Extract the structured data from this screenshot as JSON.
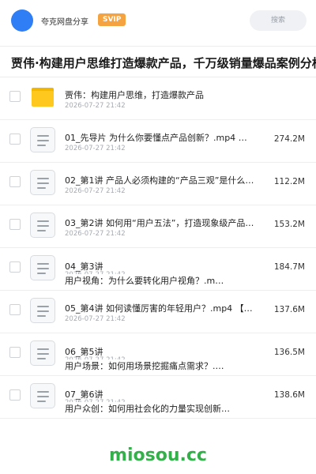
{
  "header": {
    "share_name": "夸克网盘分享",
    "badge": "SVIP",
    "search_placeholder": "搜索"
  },
  "folder_title": "贾伟·构建用户思维打造爆款产品，千万级销量爆品案例分析",
  "files": [
    {
      "type": "folder",
      "name": "贾伟：构建用户思维，打造爆款产品",
      "name2": "",
      "date": "2026-07-27 21:42",
      "size": ""
    },
    {
      "type": "file",
      "name": "01_先导片 为什么你要懂点产品创新？.mp4 【…",
      "name2": "",
      "date": "2026-07-27 21:42",
      "size": "274.2M"
    },
    {
      "type": "file",
      "name": "02_第1讲 产品人必须构建的“产品三观”是什么？…",
      "name2": "",
      "date": "2026-07-27 21:42",
      "size": "112.2M"
    },
    {
      "type": "file",
      "name": "03_第2讲 如何用“用户五法”，打造现象级产品？…",
      "name2": "",
      "date": "2026-07-27 21:42",
      "size": "153.2M"
    },
    {
      "type": "file",
      "name": "04_第3讲",
      "name2": "用户视角：为什么要转化用户视角？.m…",
      "date": "2026-07-27 21:42",
      "size": "184.7M"
    },
    {
      "type": "file",
      "name": "05_第4讲 如何读懂厉害的年轻用户？.mp4 【…",
      "name2": "",
      "date": "2026-07-27 21:42",
      "size": "137.6M"
    },
    {
      "type": "file",
      "name": "06_第5讲",
      "name2": "用户场景：如何用场景挖掘痛点需求？.…",
      "date": "2026-07-27 21:42",
      "size": "136.5M"
    },
    {
      "type": "file",
      "name": "07_第6讲",
      "name2": "用户众创：如何用社会化的力量实现创新…",
      "date": "2026-07-27 21:42",
      "size": "138.6M"
    }
  ],
  "watermark": "miosou.cc",
  "colors": {
    "avatar": "#2f7ef5",
    "badge": "#f5a341",
    "folder": "#ffc81f",
    "watermark": "#34b04a"
  }
}
